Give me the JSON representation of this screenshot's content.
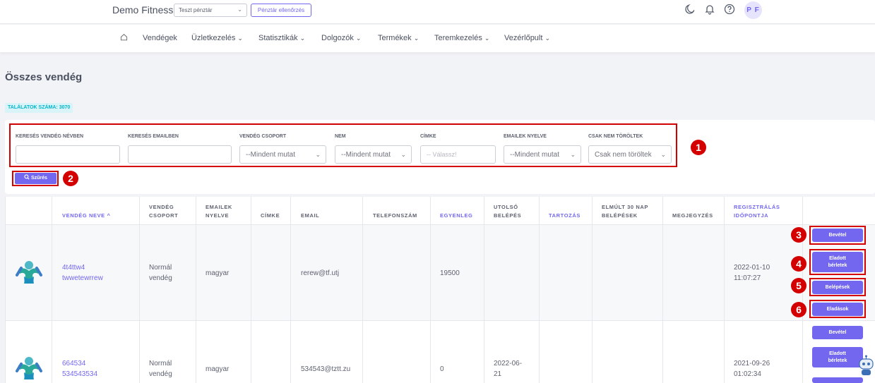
{
  "header": {
    "brand": "Demo Fitness",
    "kassza_select": "Teszt pénztár",
    "kassza_button": "Pénztár ellenőrzés",
    "avatar_initials": "P F"
  },
  "nav": {
    "items": [
      {
        "label": "Vendégek",
        "caret": ""
      },
      {
        "label": "Üzletkezelés",
        "caret": "⌄"
      },
      {
        "label": "Statisztikák",
        "caret": "⌄"
      },
      {
        "label": "Dolgozók",
        "caret": "⌄"
      },
      {
        "label": "Termékek",
        "caret": "⌄"
      },
      {
        "label": "Teremkezelés",
        "caret": "⌄"
      },
      {
        "label": "Vezérlőpult",
        "caret": "⌄"
      }
    ]
  },
  "page": {
    "title": "Összes vendég",
    "result_label": "TALÁLATOK SZÁMA:",
    "result_count": "3070"
  },
  "filters": {
    "name_label": "KERESÉS VENDÉG NÉVBEN",
    "email_label": "KERESÉS EMAILBEN",
    "group_label": "VENDÉG CSOPORT",
    "group_value": "--Mindent mutat",
    "gender_label": "NEM",
    "gender_value": "--Mindent mutat",
    "tag_label": "CÍMKE",
    "tag_placeholder": "-- Válassz!",
    "lang_label": "EMAILEK NYELVE",
    "lang_value": "--Mindent mutat",
    "deleted_label": "CSAK NEM TÖRÖLTEK",
    "deleted_value": "Csak nem töröltek",
    "filter_button": "Szűrés"
  },
  "annotations": [
    "1",
    "2",
    "3",
    "4",
    "5",
    "6"
  ],
  "table": {
    "headers": {
      "name": "VENDÉG NEVE ^",
      "group": "VENDÉG CSOPORT",
      "lang": "EMAILEK NYELVE",
      "tag": "CÍMKE",
      "email": "EMAIL",
      "phone": "TELEFONSZÁM",
      "balance": "EGYENLEG",
      "last_entry": "UTOLSÓ BELÉPÉS",
      "debt": "TARTOZÁS",
      "entries30": "ELMÚLT 30 NAP BELÉPÉSEK",
      "note": "MEGJEGYZÉS",
      "registered": "REGISZTRÁLÁS IDŐPONTJA"
    },
    "rows": [
      {
        "name1": "4t4ttw4",
        "name2": "twwetewrrew",
        "group1": "Normál",
        "group2": "vendég",
        "lang": "magyar",
        "email": "rerew@tf.utj",
        "balance": "19500",
        "last1": "",
        "last2": "",
        "reg1": "2022-01-10",
        "reg2": "11:07:27"
      },
      {
        "name1": "664534",
        "name2": "534543534",
        "group1": "Normál",
        "group2": "vendég",
        "lang": "magyar",
        "email": "534543@tztt.zu",
        "balance": "0",
        "last1": "2022-06-",
        "last2": "21",
        "reg1": "2021-09-26",
        "reg2": "01:02:34"
      }
    ],
    "actions": {
      "income": "Bevétel",
      "sold1": "Eladott",
      "sold2": "bérletek",
      "entries": "Belépések",
      "sales": "Eladások"
    }
  },
  "colors": {
    "accent": "#7367f0",
    "annotation": "#d40000",
    "badge_bg": "#d8f4f8",
    "badge_text": "#00b5cc"
  }
}
